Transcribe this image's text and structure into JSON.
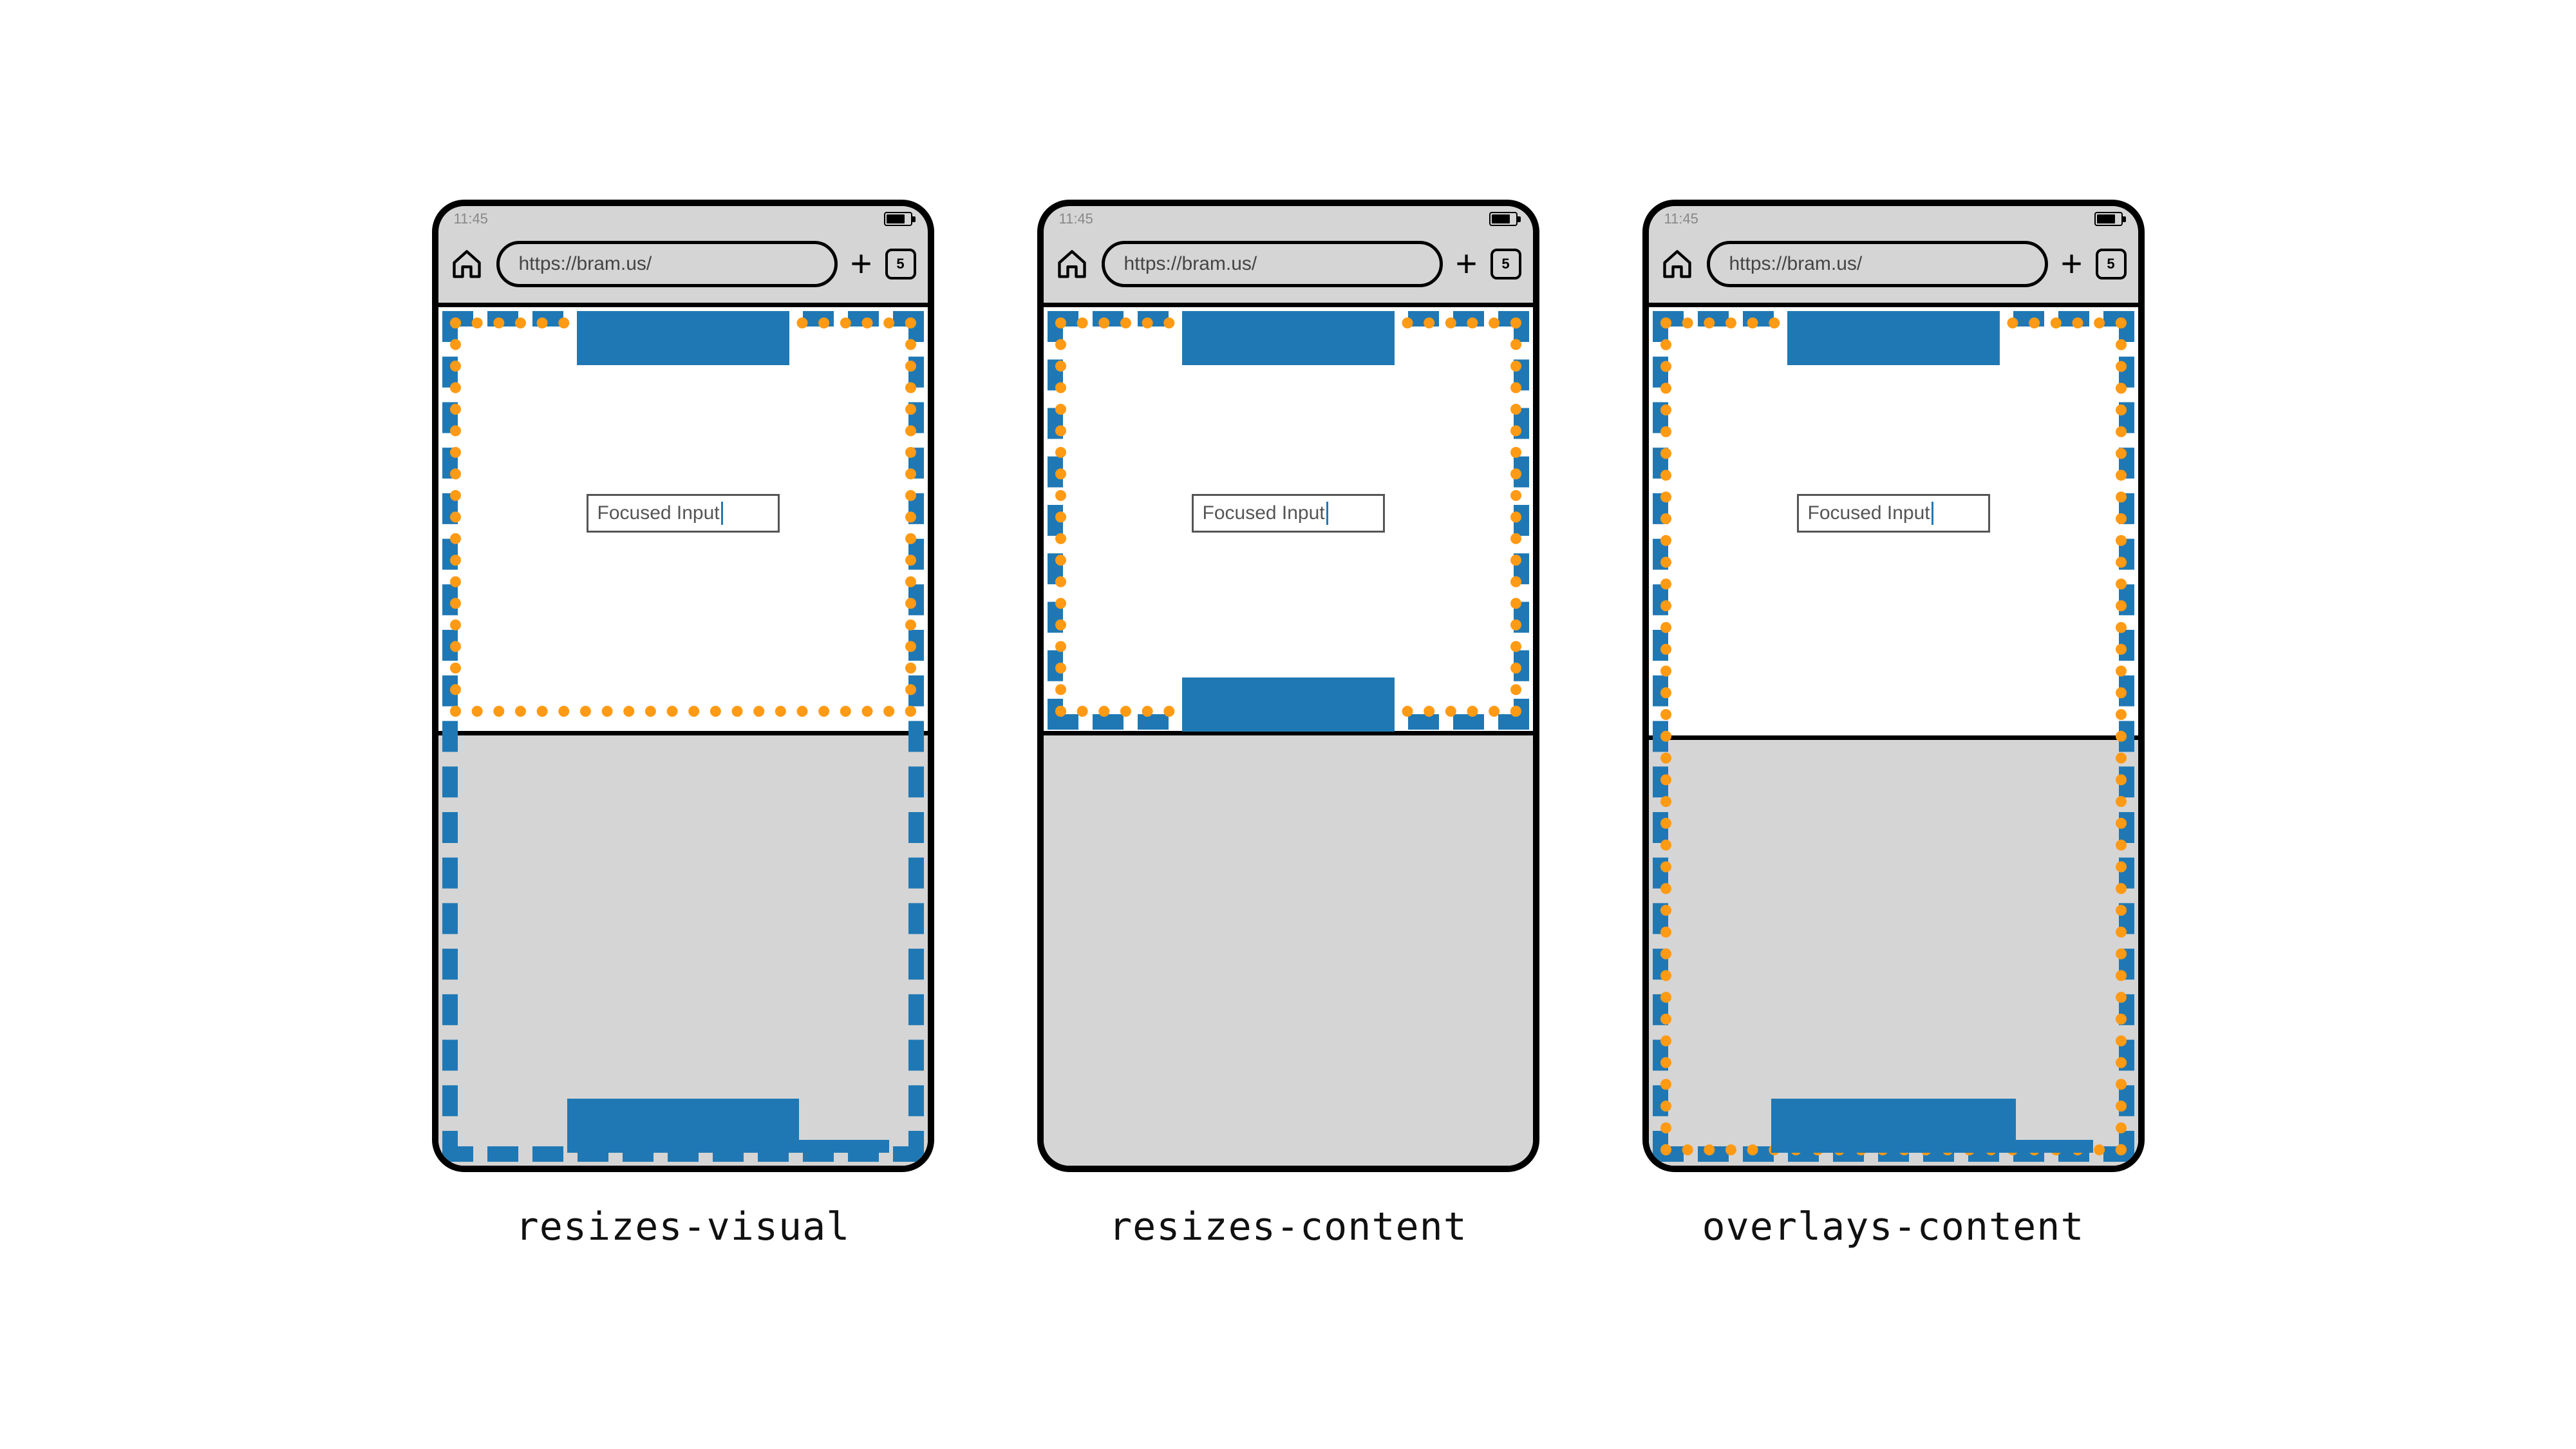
{
  "statusbar": {
    "time": "11:45"
  },
  "toolbar": {
    "url": "https://bram.us/",
    "tab_count": "5"
  },
  "page": {
    "input_label": "Focused Input"
  },
  "modes": {
    "visual": "resizes-visual",
    "content": "resizes-content",
    "overlay": "overlays-content"
  },
  "colors": {
    "accent_blue": "#1f78b4",
    "accent_orange": "#ff9a15",
    "chrome_bg": "#d5d5d5"
  }
}
